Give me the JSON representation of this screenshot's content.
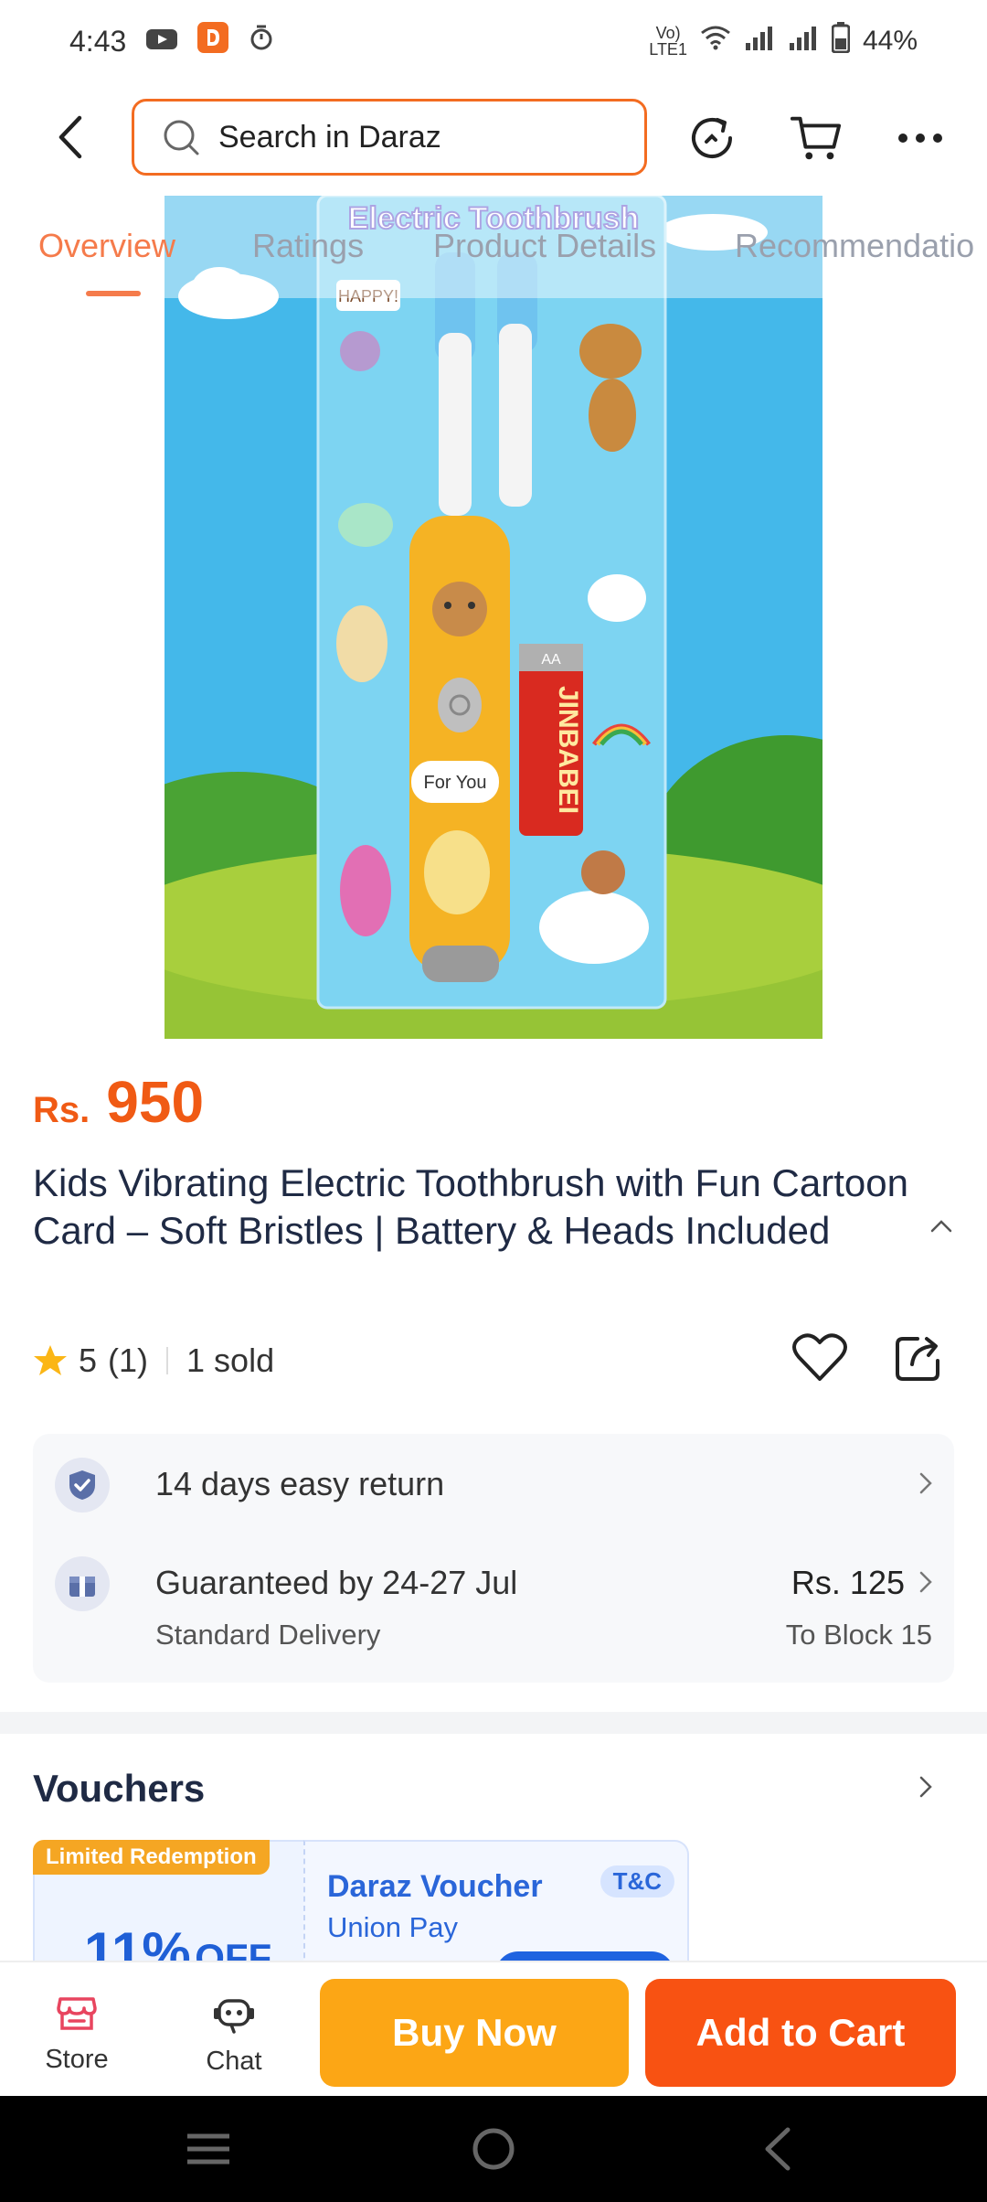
{
  "status_bar": {
    "time": "4:43",
    "battery": "44%",
    "network": "LTE1"
  },
  "header": {
    "search_placeholder": "Search in Daraz"
  },
  "tabs": [
    {
      "label": "Overview",
      "active": true
    },
    {
      "label": "Ratings",
      "active": false
    },
    {
      "label": "Product Details",
      "active": false
    },
    {
      "label": "Recommendatio",
      "active": false
    }
  ],
  "product_image": {
    "banner_text": "Electric Toothbrush",
    "sticker_happy": "HAPPY!",
    "sticker_for_you": "For You",
    "battery_brand": "JINBABEI",
    "battery_size": "AA"
  },
  "product": {
    "price_currency": "Rs.",
    "price_value": "950",
    "title": "Kids Vibrating Electric Toothbrush with Fun Cartoon Card – Soft Bristles | Battery & Heads Included",
    "rating": "5",
    "rating_count": "(1)",
    "sold": "1 sold"
  },
  "service": {
    "return_text": "14 days easy return",
    "delivery_text": "Guaranteed by 24-27 Jul",
    "delivery_sub": "Standard Delivery",
    "delivery_price": "Rs. 125",
    "delivery_location": "To Block 15"
  },
  "vouchers": {
    "title": "Vouchers",
    "badge": "Limited Redemption",
    "discount_pct": "11%",
    "discount_off": "OFF",
    "voucher_title": "Daraz Voucher",
    "voucher_sub": "Union Pay",
    "tc": "T&C"
  },
  "bottom_bar": {
    "store": "Store",
    "chat": "Chat",
    "buy_now": "Buy Now",
    "add_to_cart": "Add to Cart"
  },
  "colors": {
    "accent": "#f36c21",
    "price": "#f05a14",
    "buy_now": "#fca615",
    "add_to_cart": "#f85212"
  }
}
